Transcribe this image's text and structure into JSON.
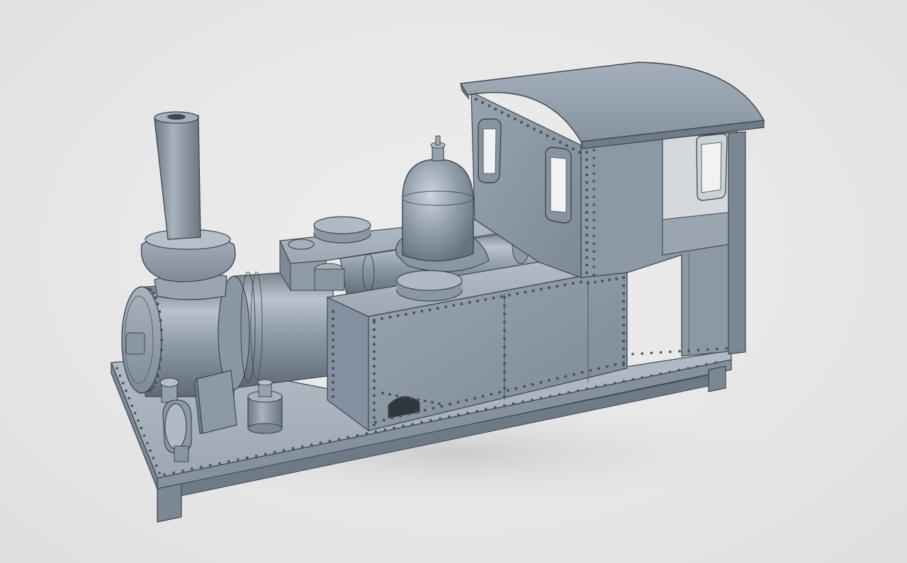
{
  "viewport": {
    "background": "#e8e8e9",
    "model_color": "#8e9aa6",
    "model": "narrow-gauge-steam-locomotive"
  }
}
